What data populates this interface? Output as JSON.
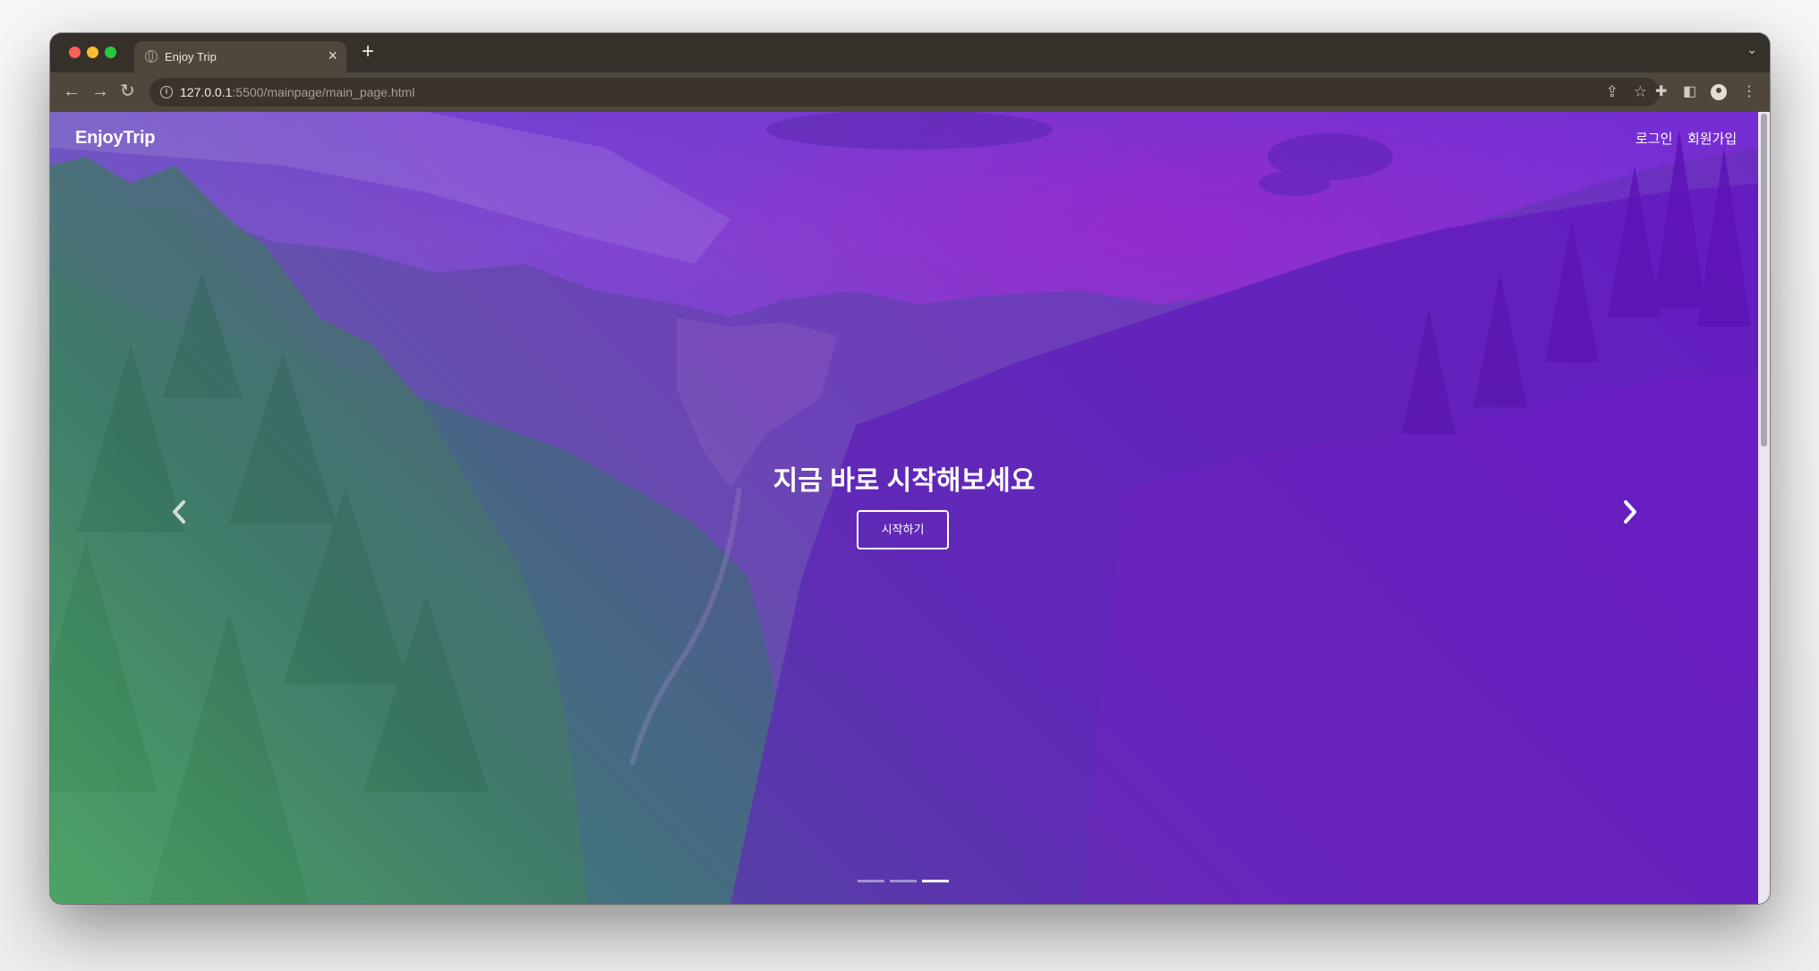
{
  "browser": {
    "tab_title": "Enjoy Trip",
    "tab_close": "×",
    "new_tab": "+",
    "tab_menu": "⌄",
    "url_host": "127.0.0.1",
    "url_path": ":5500/mainpage/main_page.html"
  },
  "page": {
    "brand": "EnjoyTrip",
    "nav": {
      "login": "로그인",
      "signup": "회원가입"
    },
    "hero": {
      "title": "지금 바로 시작해보세요",
      "button": "시작하기"
    },
    "carousel": {
      "slide_count": 3,
      "active_index": 2
    }
  },
  "colors": {
    "sky": "#7b48d4",
    "overlay_green": "#5ac86e",
    "overlay_purple": "#6e14d2"
  }
}
